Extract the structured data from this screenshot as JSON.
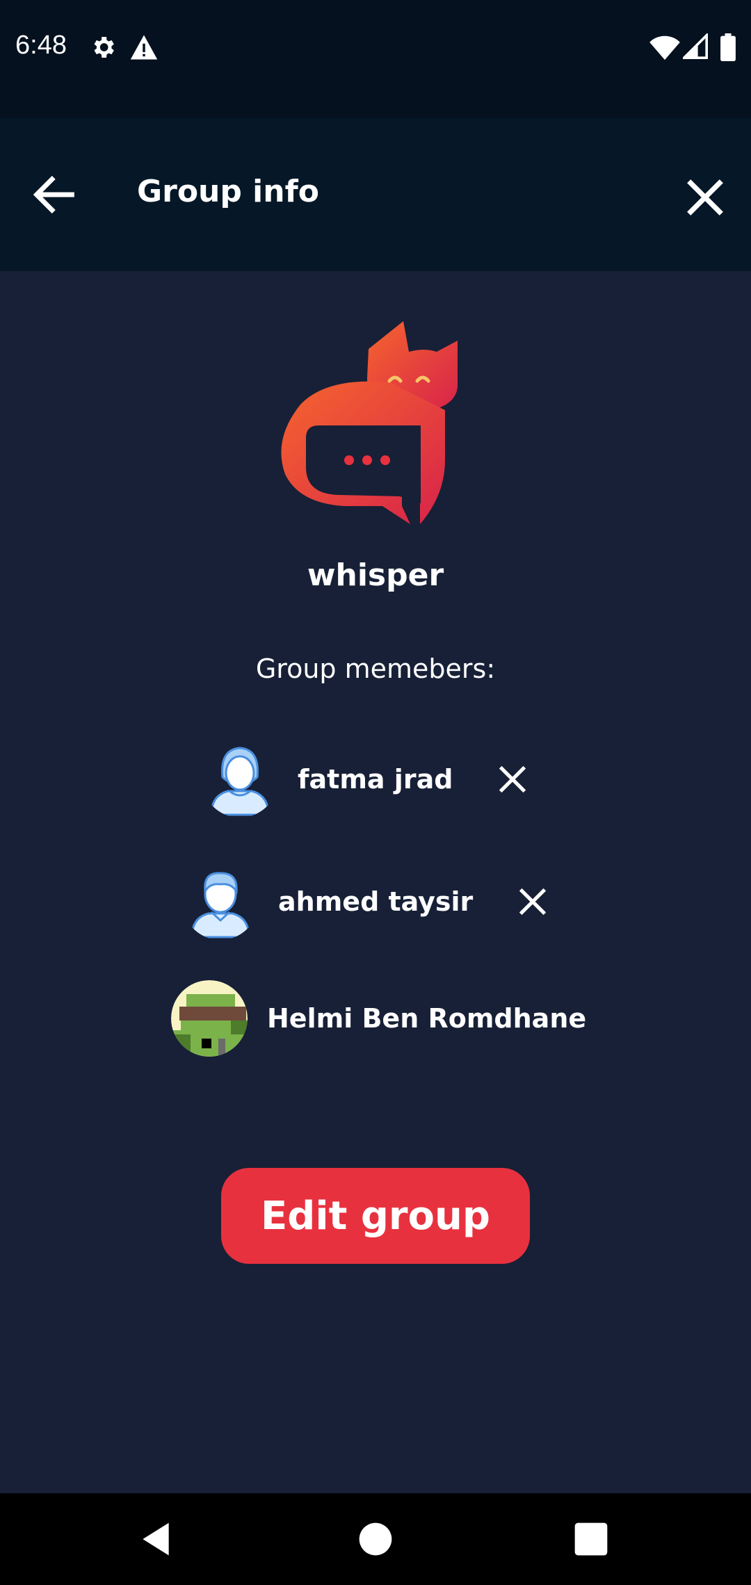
{
  "status_bar": {
    "time": "6:48",
    "icons": [
      "gear-icon",
      "warning-icon",
      "wifi-icon",
      "signal-icon",
      "battery-icon"
    ]
  },
  "app_bar": {
    "title": "Group info",
    "back_icon": "arrow-left-icon",
    "close_icon": "close-icon"
  },
  "group": {
    "logo": "whisper-cat-logo",
    "name": "whisper",
    "members_label": "Group memebers:",
    "members": [
      {
        "name": "fatma jrad",
        "avatar": "female-user-icon",
        "removable": true
      },
      {
        "name": "ahmed taysir",
        "avatar": "male-user-icon",
        "removable": true
      },
      {
        "name": "Helmi Ben Romdhane",
        "avatar": "pixel-art-avatar",
        "removable": false
      }
    ]
  },
  "actions": {
    "edit_group": "Edit group"
  },
  "colors": {
    "background": "#172036",
    "app_bar": "#061727",
    "status_bar": "#05111f",
    "accent": "#e8313f"
  },
  "nav_bar": {
    "icons": [
      "back-triangle-icon",
      "home-circle-icon",
      "recents-square-icon"
    ]
  }
}
